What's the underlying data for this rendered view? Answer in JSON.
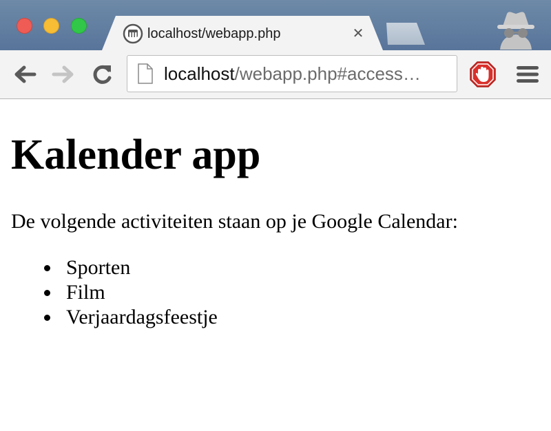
{
  "browser": {
    "tab": {
      "title": "localhost/webapp.php",
      "close_glyph": "✕",
      "favicon": "server-icon"
    },
    "address_bar": {
      "host": "localhost",
      "path": "/webapp.php#access…"
    },
    "icons": {
      "back": "back-arrow-icon",
      "forward": "forward-arrow-icon",
      "reload": "reload-icon",
      "page": "page-icon",
      "adblock": "adblock-hand-icon",
      "menu": "hamburger-menu-icon",
      "incognito": "incognito-icon"
    },
    "colors": {
      "titlebar": "#5f7b9e",
      "close": "#ee5c55",
      "minimize": "#f6bd35",
      "maximize": "#31c748",
      "adblock": "#d9302c"
    }
  },
  "page": {
    "title": "Kalender app",
    "intro": "De volgende activiteiten staan op je Google Calendar:",
    "activities": [
      "Sporten",
      "Film",
      "Verjaardagsfeestje"
    ]
  }
}
